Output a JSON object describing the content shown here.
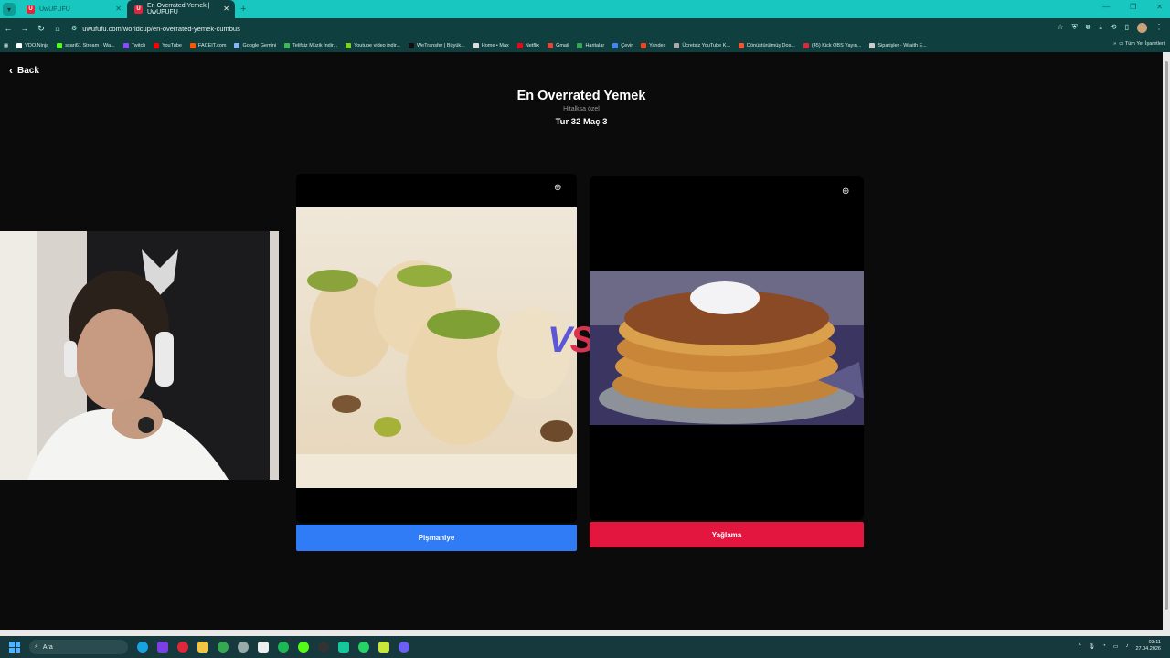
{
  "browser": {
    "tabs": [
      {
        "label": "UwUFUFU",
        "active": false
      },
      {
        "label": "En Overrated Yemek | UwUFUFU",
        "active": true
      }
    ],
    "url": "uwufufu.com/worldcup/en-overrated-yemek-cumbus",
    "bookmarks": [
      "VDO.Ninja",
      "ssari61 Stream - Wa...",
      "Twitch",
      "YouTube",
      "FACEIT.com",
      "Google Gemini",
      "Telifsiz Müzik İndir...",
      "Youtube video indir...",
      "WeTransfer | Büyük...",
      "Home • Max",
      "Netflix",
      "Gmail",
      "Haritalar",
      "Çevir",
      "Yandex",
      "Ücretsiz YouTube K...",
      "Dönüştürülmüş Dos...",
      "(45) Kick OBS Yayın...",
      "Siparişler - Wraith E..."
    ],
    "bookmarks_other": "Tüm Yer İşaretleri"
  },
  "page": {
    "back_label": "Back",
    "title": "En Overrated Yemek",
    "subtitle": "Hitalksa özel",
    "round": "Tur 32 Maç 3",
    "vs": {
      "v": "V",
      "s": "S"
    },
    "left_choice": {
      "label": "Pişmaniye",
      "color": "#2f7cf6"
    },
    "right_choice": {
      "label": "Yağlama",
      "color": "#e3163f"
    }
  },
  "taskbar": {
    "search_placeholder": "Ara",
    "time": "03:11",
    "date": "27.04.2026"
  }
}
